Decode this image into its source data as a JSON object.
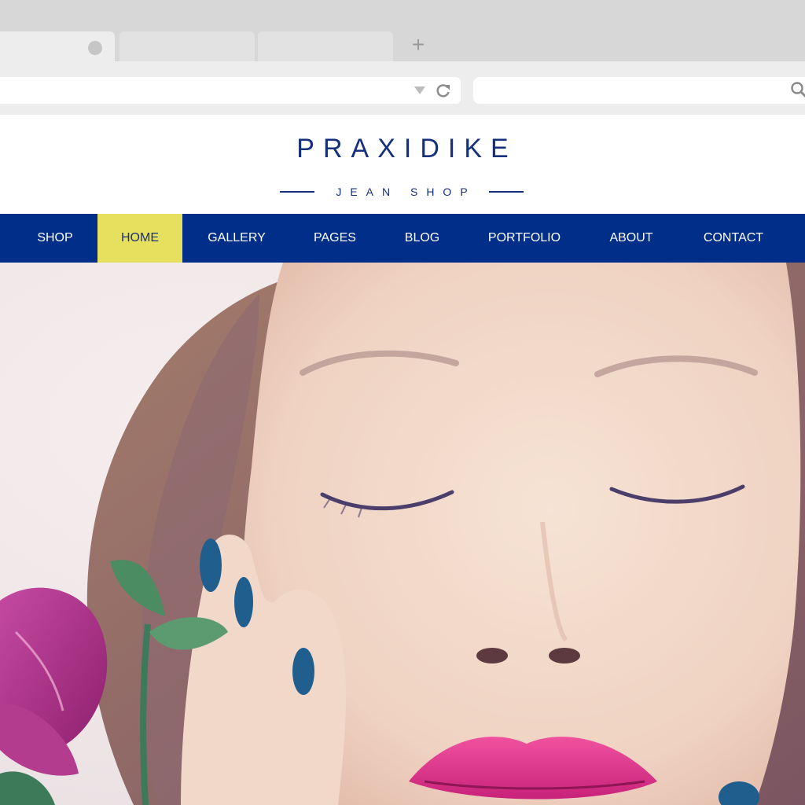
{
  "browser": {
    "new_tab_symbol": "+",
    "icons": {
      "dropdown": "chevron-down-icon",
      "reload": "reload-icon",
      "search": "search-icon"
    }
  },
  "site": {
    "logo_title": "PRAXIDIKE",
    "logo_subtitle": "JEAN SHOP",
    "nav": [
      {
        "label": "SHOP",
        "active": false
      },
      {
        "label": "HOME",
        "active": true
      },
      {
        "label": "GALLERY",
        "active": false
      },
      {
        "label": "PAGES",
        "active": false
      },
      {
        "label": "BLOG",
        "active": false
      },
      {
        "label": "PORTFOLIO",
        "active": false
      },
      {
        "label": "ABOUT",
        "active": false
      },
      {
        "label": "CONTACT",
        "active": false
      }
    ],
    "colors": {
      "brand_blue": "#16307a",
      "nav_background": "#002e88",
      "nav_active": "#e5e05d",
      "nav_text": "#ffffff"
    }
  }
}
